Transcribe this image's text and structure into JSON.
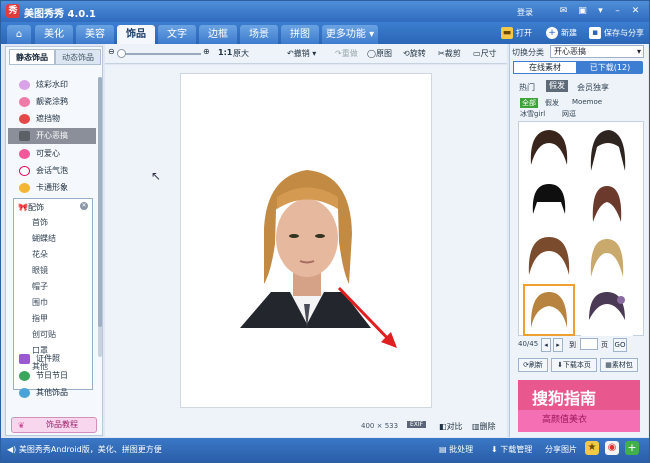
{
  "app": {
    "title": "美图秀秀 4.0.1",
    "login": "登录"
  },
  "tabs": [
    {
      "label": "美化"
    },
    {
      "label": "美容"
    },
    {
      "label": "饰品"
    },
    {
      "label": "文字"
    },
    {
      "label": "边框"
    },
    {
      "label": "场景"
    },
    {
      "label": "拼图"
    },
    {
      "label": "更多功能 ▾"
    }
  ],
  "top_actions": {
    "open": "打开",
    "new": "新建",
    "save": "保存与分享"
  },
  "toolbar": {
    "zoom_ratio": "1:1",
    "original_size": "原大",
    "undo": "撤销",
    "redo": "重做",
    "original": "原图",
    "rotate": "旋转",
    "crop": "裁剪",
    "size": "尺寸"
  },
  "left": {
    "tab_static": "静态饰品",
    "tab_animated": "动态饰品",
    "items": [
      {
        "label": "炫彩水印"
      },
      {
        "label": "靓瓷涂鸦"
      },
      {
        "label": "遮挡物"
      },
      {
        "label": "开心恶搞"
      },
      {
        "label": "可爱心"
      },
      {
        "label": "会话气泡"
      },
      {
        "label": "卡通形象"
      },
      {
        "label": "配饰"
      }
    ],
    "sub": [
      "首饰",
      "蝴蝶结",
      "花朵",
      "眼镜",
      "帽子",
      "围巾",
      "指甲",
      "创可贴",
      "口罩",
      "其他"
    ],
    "bottom_items": [
      {
        "label": "证件照"
      },
      {
        "label": "节日节日"
      },
      {
        "label": "其他饰品"
      }
    ],
    "tutorial": "饰品教程"
  },
  "canvas": {
    "size_w": "400",
    "size_h": "533",
    "exif": "EXIF",
    "compare": "对比",
    "delete": "删除"
  },
  "right": {
    "category_label": "切换分类",
    "category_value": "开心恶搞",
    "tab_online": "在线素材",
    "tab_downloaded": "已下载(12)",
    "subtabs": [
      "热门",
      "假发",
      "会员独享"
    ],
    "filters": [
      "全部",
      "假发",
      "Moemoe",
      "冰雪girl",
      "网逗"
    ],
    "pager": "40/45",
    "to": "到",
    "page_suffix": "页",
    "go": "GO",
    "refresh": "刷新",
    "download_page": "下载本页",
    "material": "素材包",
    "ad_line1": "搜狗指南",
    "ad_line2": "高颜值美衣"
  },
  "status": {
    "left": "美图秀秀Android版，美化、拼图更方便",
    "batch": "批处理",
    "download_mgr": "下载管理",
    "share": "分享图片"
  }
}
